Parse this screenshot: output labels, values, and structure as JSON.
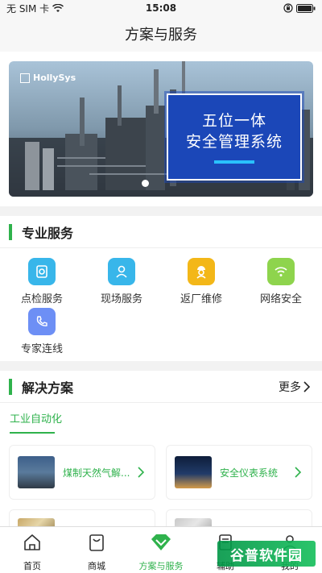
{
  "status_bar": {
    "carrier": "无 SIM 卡",
    "time": "15:08"
  },
  "nav": {
    "title": "方案与服务"
  },
  "banner": {
    "logo_text": "HollySys",
    "line1": "五位一体",
    "line2": "安全管理系统"
  },
  "professional_services": {
    "title": "专业服务",
    "items": [
      {
        "label": "点检服务",
        "icon": "inspection-icon",
        "color": "#38b6ea"
      },
      {
        "label": "现场服务",
        "icon": "onsite-icon",
        "color": "#38b6ea"
      },
      {
        "label": "返厂维修",
        "icon": "repair-icon",
        "color": "#f3b718"
      },
      {
        "label": "网络安全",
        "icon": "wifi-icon",
        "color": "#8ed44d"
      },
      {
        "label": "专家连线",
        "icon": "phone-icon",
        "color": "#6d8ff5"
      }
    ]
  },
  "solutions": {
    "title": "解决方案",
    "more_label": "更多",
    "active_tab": "工业自动化",
    "cards": [
      {
        "title": "煤制天然气解..."
      },
      {
        "title": "安全仪表系统"
      }
    ]
  },
  "tabbar": {
    "items": [
      {
        "label": "首页",
        "icon": "home-icon"
      },
      {
        "label": "商城",
        "icon": "shopping-bag-icon"
      },
      {
        "label": "方案与服务",
        "icon": "diamond-icon",
        "active": true
      },
      {
        "label": "辅助",
        "icon": "news-icon"
      },
      {
        "label": "我的",
        "icon": "profile-icon"
      }
    ]
  },
  "watermark": "谷普软件园",
  "colors": {
    "accent": "#2fb24c"
  }
}
